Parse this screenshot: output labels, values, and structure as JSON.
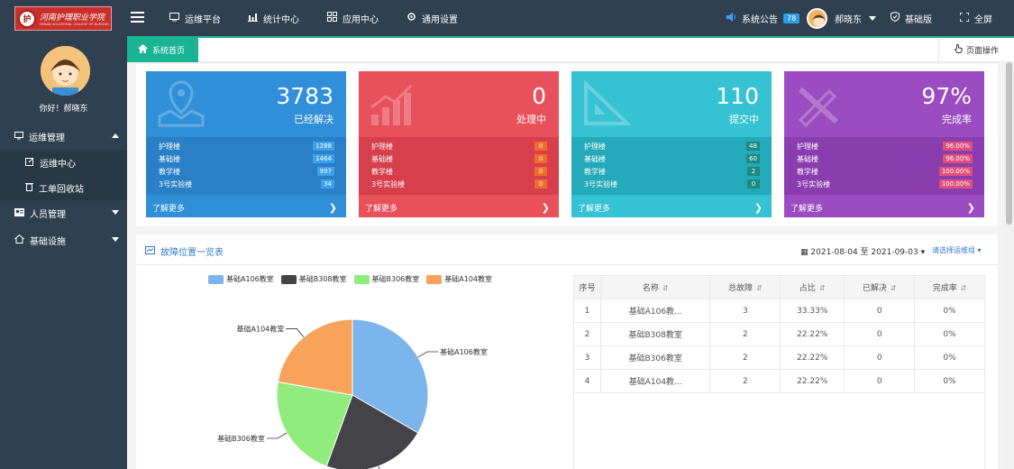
{
  "app": {
    "logo_cn": "河南护理职业学院",
    "logo_en": "HENAN VOCATIONAL COLLEGE OF NURSING",
    "logo_seal": "护"
  },
  "topnav": {
    "items": [
      {
        "icon": "monitor-icon",
        "label": "运维平台"
      },
      {
        "icon": "bar-chart-icon",
        "label": "统计中心"
      },
      {
        "icon": "grid-icon",
        "label": "应用中心"
      },
      {
        "icon": "gear-icon",
        "label": "通用设置"
      }
    ],
    "notice_label": "系统公告",
    "notice_count": "78",
    "username": "郝晓东",
    "edition": "基础版",
    "fullscreen": "全屏"
  },
  "sidebar": {
    "greeting": "你好！郝晓东",
    "items": [
      {
        "label": "运维管理",
        "icon": "monitor-icon"
      },
      {
        "label": "运维中心",
        "icon": "edit-icon"
      },
      {
        "label": "工单回收站",
        "icon": "trash-icon"
      },
      {
        "label": "人员管理",
        "icon": "users-icon"
      },
      {
        "label": "基础设施",
        "icon": "home-icon"
      }
    ]
  },
  "tabs": {
    "home": "系统首页",
    "page_ops": "页面操作"
  },
  "cards": [
    {
      "value": "3783",
      "label": "已经解决",
      "color": "#2f8fd8",
      "rows_color": "#2a7fc6",
      "rows": [
        {
          "k": "护理楼",
          "v": "1288"
        },
        {
          "k": "基础楼",
          "v": "1464"
        },
        {
          "k": "教学楼",
          "v": "997"
        },
        {
          "k": "3号实验楼",
          "v": "34"
        }
      ],
      "badge": "#3da1ec",
      "more": "了解更多"
    },
    {
      "value": "0",
      "label": "处理中",
      "color": "#e8505b",
      "rows_color": "#d63f4b",
      "rows": [
        {
          "k": "护理楼",
          "v": "0"
        },
        {
          "k": "基础楼",
          "v": "0"
        },
        {
          "k": "教学楼",
          "v": "0"
        },
        {
          "k": "3号实验楼",
          "v": "0"
        }
      ],
      "badge": "#f26b28",
      "more": "了解更多"
    },
    {
      "value": "110",
      "label": "提交中",
      "color": "#35c2d2",
      "rows_color": "#23a9b9",
      "rows": [
        {
          "k": "护理楼",
          "v": "48"
        },
        {
          "k": "基础楼",
          "v": "60"
        },
        {
          "k": "教学楼",
          "v": "2"
        },
        {
          "k": "3号实验楼",
          "v": "0"
        }
      ],
      "badge": "#1b8a82",
      "more": "了解更多"
    },
    {
      "value": "97%",
      "label": "完成率",
      "color": "#9b4cc0",
      "rows_color": "#8a3daf",
      "rows": [
        {
          "k": "护理楼",
          "v": "96.00%"
        },
        {
          "k": "基础楼",
          "v": "96.00%"
        },
        {
          "k": "教学楼",
          "v": "100.00%"
        },
        {
          "k": "3号实验楼",
          "v": "100.00%"
        }
      ],
      "badge": "#e0507a",
      "more": "了解更多"
    }
  ],
  "panel": {
    "title": "故障位置一览表",
    "date_range": "2021-08-04 至 2021-09-03",
    "selector": "请选择运维组"
  },
  "chart_data": {
    "type": "pie",
    "categories": [
      "基础A106教室",
      "基础B308教室",
      "基础B306教室",
      "基础A104教室"
    ],
    "values": [
      3,
      2,
      2,
      2
    ],
    "colors": [
      "#7cb5ec",
      "#434348",
      "#90ed7d",
      "#f7a35c"
    ],
    "legend": "top"
  },
  "table": {
    "headers": [
      "序号",
      "名称",
      "总故障",
      "占比",
      "已解决",
      "完成率"
    ],
    "rows": [
      [
        "1",
        "基础A106教...",
        "3",
        "33.33%",
        "0",
        "0%"
      ],
      [
        "2",
        "基础B308教室",
        "2",
        "22.22%",
        "0",
        "0%"
      ],
      [
        "3",
        "基础B306教室",
        "2",
        "22.22%",
        "0",
        "0%"
      ],
      [
        "4",
        "基础A104教...",
        "2",
        "22.22%",
        "0",
        "0%"
      ]
    ]
  }
}
